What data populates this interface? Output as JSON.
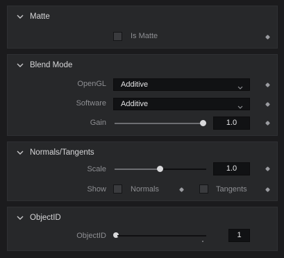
{
  "matte": {
    "title": "Matte",
    "is_matte_label": "Is Matte",
    "is_matte_checked": false
  },
  "blend_mode": {
    "title": "Blend Mode",
    "opengl_label": "OpenGL",
    "opengl_value": "Additive",
    "software_label": "Software",
    "software_value": "Additive",
    "gain_label": "Gain",
    "gain_value": "1.0",
    "gain_slider_fraction": 1.0
  },
  "normals_tangents": {
    "title": "Normals/Tangents",
    "scale_label": "Scale",
    "scale_value": "1.0",
    "scale_slider_fraction": 0.5,
    "show_label": "Show",
    "normals_label": "Normals",
    "normals_checked": false,
    "tangents_label": "Tangents",
    "tangents_checked": false
  },
  "object_id": {
    "title": "ObjectID",
    "objectid_label": "ObjectID",
    "objectid_value": "1",
    "objectid_slider_fraction": 0.0
  },
  "icons": {
    "section_toggle": "chevron-down-icon",
    "keyframe": "keyframe-diamond-icon",
    "dropdown": "chevron-down-icon"
  },
  "colors": {
    "background": "#1b1b1d",
    "panel": "#27282a",
    "field": "#111214"
  }
}
